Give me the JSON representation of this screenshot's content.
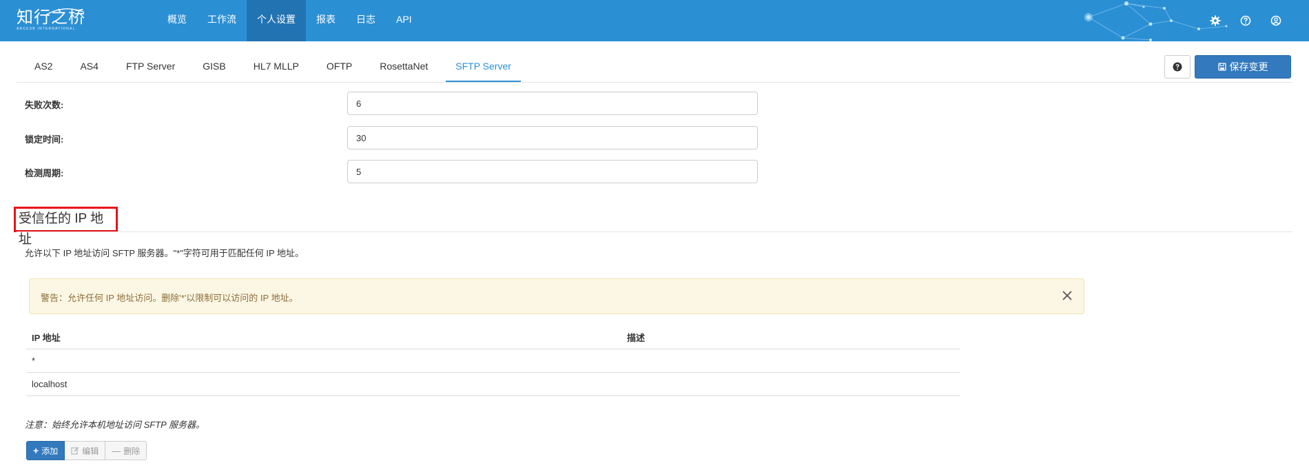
{
  "header": {
    "logo_text": "知行之桥",
    "logo_subtext": "ARCESB INTERNATIONAL",
    "nav": [
      {
        "label": "概览",
        "active": false
      },
      {
        "label": "工作流",
        "active": false
      },
      {
        "label": "个人设置",
        "active": true
      },
      {
        "label": "报表",
        "active": false
      },
      {
        "label": "日志",
        "active": false
      },
      {
        "label": "API",
        "active": false
      }
    ],
    "icons": [
      "gear-icon",
      "help-circle-icon",
      "user-circle-icon"
    ],
    "brand_color": "#2b8fd4"
  },
  "tabs": [
    {
      "label": "AS2",
      "active": false
    },
    {
      "label": "AS4",
      "active": false
    },
    {
      "label": "FTP Server",
      "active": false
    },
    {
      "label": "GISB",
      "active": false
    },
    {
      "label": "HL7 MLLP",
      "active": false
    },
    {
      "label": "OFTP",
      "active": false
    },
    {
      "label": "RosettaNet",
      "active": false
    },
    {
      "label": "SFTP Server",
      "active": true
    }
  ],
  "toolbar": {
    "save_label": "保存变更"
  },
  "form": {
    "fields": [
      {
        "label": "失败次数:",
        "value": "6"
      },
      {
        "label": "锁定时间:",
        "value": "30"
      },
      {
        "label": "检测周期:",
        "value": "5"
      }
    ]
  },
  "trusted": {
    "title": "受信任的 IP 地址",
    "description": "允许以下 IP 地址访问 SFTP 服务器。\"*\"字符可用于匹配任何 IP 地址。",
    "alert": "警告：允许任何 IP 地址访问。删除'*'以限制可以访问的 IP 地址。",
    "alert_color": "#fcf7e4",
    "columns": [
      "IP 地址",
      "描述"
    ],
    "rows": [
      {
        "ip": "*",
        "desc": ""
      },
      {
        "ip": "localhost",
        "desc": ""
      }
    ],
    "note": "注意：始终允许本机地址访问 SFTP 服务器。",
    "buttons": {
      "add": "添加",
      "edit": "编辑",
      "delete": "删除"
    }
  }
}
